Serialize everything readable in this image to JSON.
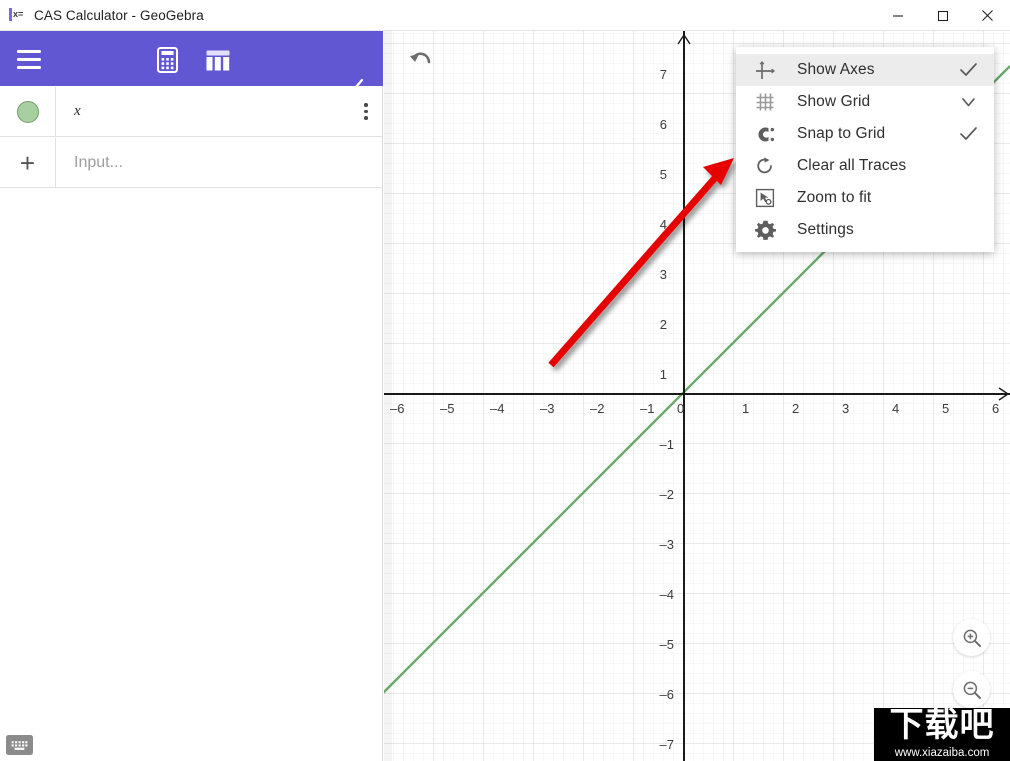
{
  "window": {
    "title": "CAS Calculator - GeoGebra",
    "icon_name": "geogebra-cas-icon",
    "icon_text": "x=",
    "controls": [
      {
        "name": "minimize-button",
        "label": "—"
      },
      {
        "name": "maximize-button",
        "label": "□"
      },
      {
        "name": "close-button",
        "label": "✕"
      }
    ]
  },
  "sidebar": {
    "accent_color": "#6257d3",
    "menu_button": "menu-hamburger",
    "tools": [
      {
        "name": "calculator-tool",
        "icon": "calculator-icon",
        "active": true
      },
      {
        "name": "table-tool",
        "icon": "table-icon",
        "active": false
      }
    ],
    "collapse_icon": "chevron-left-icon",
    "rows": [
      {
        "marble_color": "#a8cfa0",
        "expression": "x",
        "kebab": "more-options-icon"
      }
    ],
    "input": {
      "placeholder": "Input...",
      "value": "",
      "add_label": "+"
    },
    "keyboard_button": "keyboard-icon"
  },
  "graph": {
    "undo_icon": "undo-icon",
    "zoom_in_icon": "zoom-in-icon",
    "zoom_out_icon": "zoom-out-icon",
    "grid_color": "#d8d8d8",
    "minor_grid_color": "#efefef",
    "axis_color": "#1a1a1a",
    "function_color": "#6aa96a",
    "annotation_color": "#e60000"
  },
  "chart_data": {
    "type": "line",
    "title": "",
    "xlabel": "",
    "ylabel": "",
    "xlim": [
      -6.4,
      6.2
    ],
    "ylim": [
      -7.3,
      7.3
    ],
    "xticks": [
      -6,
      -5,
      -4,
      -3,
      -2,
      -1,
      0,
      1,
      2,
      3,
      4,
      5,
      6
    ],
    "yticks": [
      7,
      6,
      5,
      4,
      3,
      2,
      1,
      0,
      -1,
      -2,
      -3,
      -4,
      -5,
      -6,
      -7
    ],
    "xticklabels": [
      "–6",
      "–5",
      "–4",
      "–3",
      "–2",
      "–1",
      "0",
      "1",
      "2",
      "3",
      "4",
      "5",
      "6"
    ],
    "yticklabels": [
      "7",
      "6",
      "5",
      "4",
      "3",
      "2",
      "1",
      "0",
      "–1",
      "–2",
      "–3",
      "–4",
      "–5",
      "–6",
      "–7"
    ],
    "grid": true,
    "minor_grid_step": 0.2,
    "major_grid_step": 1,
    "legend": "none",
    "series": [
      {
        "name": "x",
        "type": "line",
        "equation": "y = x",
        "color": "#6aa96a",
        "x": [
          -6.4,
          6.2
        ],
        "y": [
          -6.4,
          6.2
        ]
      }
    ],
    "annotations": [
      {
        "type": "arrow",
        "color": "#e60000",
        "from": [
          -2.66,
          0.0
        ],
        "to": [
          0.95,
          4.2
        ],
        "points_at": "show-grid-menu-item"
      }
    ]
  },
  "context_menu": {
    "items": [
      {
        "id": "show-axes",
        "label": "Show Axes",
        "icon": "axes-icon",
        "mark": "check",
        "highlighted": true
      },
      {
        "id": "show-grid",
        "label": "Show Grid",
        "icon": "grid-icon",
        "mark": "chevron",
        "highlighted": false
      },
      {
        "id": "snap-to-grid",
        "label": "Snap to Grid",
        "icon": "magnet-icon",
        "mark": "check",
        "highlighted": false
      },
      {
        "id": "clear-all-traces",
        "label": "Clear all Traces",
        "icon": "refresh-icon",
        "mark": "none",
        "highlighted": false
      },
      {
        "id": "zoom-to-fit",
        "label": "Zoom to fit",
        "icon": "zoom-to-fit-icon",
        "mark": "none",
        "highlighted": false
      },
      {
        "id": "settings",
        "label": "Settings",
        "icon": "gear-icon",
        "mark": "none",
        "highlighted": false
      }
    ]
  },
  "watermark": {
    "text": "下载吧",
    "url": "www.xiazaiba.com"
  }
}
